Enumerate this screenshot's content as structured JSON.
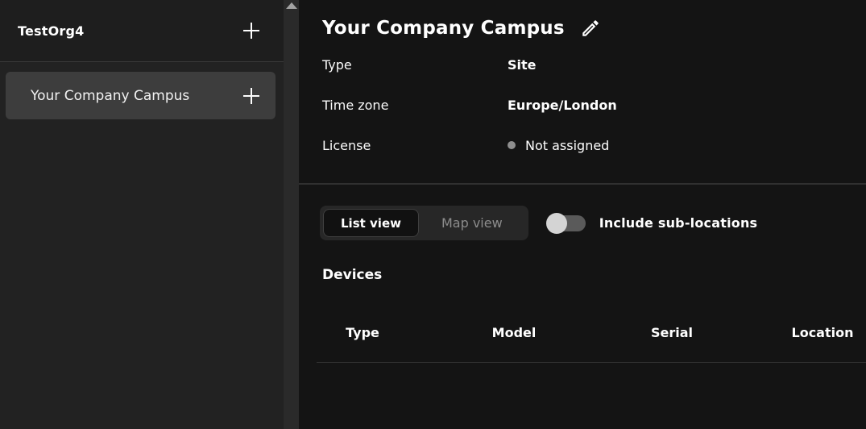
{
  "colors": {
    "sidebar_bg": "#222222",
    "sidebar_header_bg": "#1e1e1e",
    "selected_item_bg": "#3d3d3d",
    "main_bg": "#141414",
    "scrollbar_track": "#2a2a2a",
    "divider": "#303030",
    "muted_text": "#8c8c8c",
    "status_dot": "#8f8f8f",
    "toggle_track": "#5a5a5a",
    "toggle_knob": "#d4d4d4"
  },
  "sidebar": {
    "org": {
      "name": "TestOrg4",
      "add_icon": "plus-icon"
    },
    "items": [
      {
        "label": "Your Company Campus",
        "selected": true,
        "add_icon": "plus-icon"
      }
    ]
  },
  "scrollbar": {
    "up_icon": "triangle-up-icon"
  },
  "main": {
    "title": "Your Company Campus",
    "edit_icon": "pencil-icon",
    "properties": [
      {
        "label": "Type",
        "value": "Site"
      },
      {
        "label": "Time zone",
        "value": "Europe/London"
      },
      {
        "label": "License",
        "value": "Not assigned",
        "has_status_dot": true
      }
    ],
    "view_switch": {
      "options": [
        {
          "label": "List view",
          "selected": true
        },
        {
          "label": "Map view",
          "selected": false
        }
      ]
    },
    "include_sublocations": {
      "label": "Include sub-locations",
      "enabled": false
    },
    "devices": {
      "heading": "Devices",
      "columns": [
        "Type",
        "Model",
        "Serial",
        "Location"
      ],
      "rows": []
    }
  }
}
